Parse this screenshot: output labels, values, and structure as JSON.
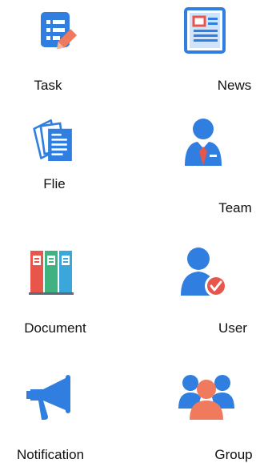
{
  "app": {
    "items": [
      {
        "label": "Task",
        "icon": "task-icon"
      },
      {
        "label": "News",
        "icon": "news-icon"
      },
      {
        "label": "Flie",
        "icon": "file-icon"
      },
      {
        "label": "Team",
        "icon": "team-icon"
      },
      {
        "label": "Document",
        "icon": "document-icon"
      },
      {
        "label": "User",
        "icon": "user-icon"
      },
      {
        "label": "Notification",
        "icon": "notification-icon"
      },
      {
        "label": "Group",
        "icon": "group-icon"
      }
    ]
  },
  "colors": {
    "blue": "#2f7ee0",
    "light_blue": "#cfe3fb",
    "red": "#e8564b",
    "green": "#3fb27f",
    "cyan": "#3aa6d9",
    "gray": "#5b6a78",
    "orange": "#f07a5e"
  }
}
